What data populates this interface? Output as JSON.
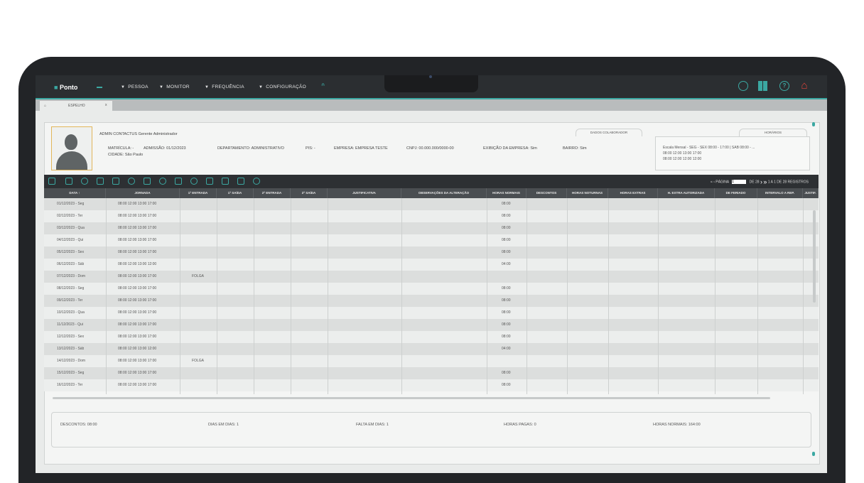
{
  "topbar": {
    "logo": "Ponto",
    "menu": [
      "PESSOA",
      "MONITOR",
      "FREQUÊNCIA",
      "CONFIGURAÇÃO"
    ]
  },
  "tab": {
    "label": "ESPELHO",
    "close": "x"
  },
  "employee": {
    "name_line": "ADMIN CONTACTUS Gerente Administrador",
    "matricula": "MATRÍCULA: -",
    "admissao": "ADMISSÃO: 01/12/2023",
    "departamento": "DEPARTAMENTO: ADMINISTRATIVO",
    "pis": "PIS: -",
    "empresa": "EMPRESA: EMPRESA TESTE",
    "cnpj": "CNPJ: 00.000.000/0000-00",
    "exibicao": "EXIBIÇÃO DA EMPRESA: Sim",
    "bairro": "BAIRRO: Sim",
    "cidade": "CIDADE: São Paulo"
  },
  "dados_tab": "DADOS COLABORADOR",
  "horarios_tab": "HORÁRIOS",
  "horarios_box": {
    "line1": "Escala Mensal - SEG - SEX 08:00 - 17:00 | SAB 08:00 - ...",
    "line2": "08:00 12:00 13:00 17:00",
    "line3": "08:00 12:00 12:00 12:00"
  },
  "pager": {
    "label": "PÁGINA",
    "value": "1",
    "of": "DE 28",
    "summary": "1 A 1 DE 28 REGISTROS"
  },
  "columns": [
    "DATA ↑",
    "JORNADA",
    "1ª ENTRADA",
    "1ª SAÍDA",
    "2ª ENTRADA",
    "2ª SAÍDA",
    "JUSTIFICATIVA",
    "OBSERVAÇÕES DA ALTERAÇÃO",
    "HORAS NORMAIS",
    "DESCONTOS",
    "HORAS NOTURNAS",
    "HORAS EXTRAS",
    "H. EXTRA AUTORIZADA",
    "DE FERIADO",
    "INTERVALO A REP.",
    "JUSTIF."
  ],
  "rows": [
    {
      "date": "01/12/2023 - Seg",
      "jornada": "08:00 12:00 13:00 17:00",
      "e1": "",
      "hn": "08:00"
    },
    {
      "date": "02/12/2023 - Ter",
      "jornada": "08:00 12:00 13:00 17:00",
      "e1": "",
      "hn": "08:00"
    },
    {
      "date": "03/12/2023 - Qua",
      "jornada": "08:00 12:00 13:00 17:00",
      "e1": "",
      "hn": "08:00"
    },
    {
      "date": "04/12/2023 - Qui",
      "jornada": "08:00 12:00 13:00 17:00",
      "e1": "",
      "hn": "08:00"
    },
    {
      "date": "05/12/2023 - Sex",
      "jornada": "08:00 12:00 13:00 17:00",
      "e1": "",
      "hn": "08:00"
    },
    {
      "date": "06/12/2023 - Sáb",
      "jornada": "08:00 12:00 13:00 12:00",
      "e1": "",
      "hn": "04:00"
    },
    {
      "date": "07/12/2023 - Dom",
      "jornada": "08:00 12:00 13:00 17:00",
      "e1": "FOLGA",
      "hn": ""
    },
    {
      "date": "08/12/2023 - Seg",
      "jornada": "08:00 12:00 13:00 17:00",
      "e1": "",
      "hn": "08:00"
    },
    {
      "date": "09/12/2023 - Ter",
      "jornada": "08:00 12:00 13:00 17:00",
      "e1": "",
      "hn": "08:00"
    },
    {
      "date": "10/12/2023 - Qua",
      "jornada": "08:00 12:00 13:00 17:00",
      "e1": "",
      "hn": "08:00"
    },
    {
      "date": "11/12/2023 - Qui",
      "jornada": "08:00 12:00 13:00 17:00",
      "e1": "",
      "hn": "08:00"
    },
    {
      "date": "12/12/2023 - Sex",
      "jornada": "08:00 12:00 13:00 17:00",
      "e1": "",
      "hn": "08:00"
    },
    {
      "date": "13/12/2023 - Sáb",
      "jornada": "08:00 12:00 13:00 12:00",
      "e1": "",
      "hn": "04:00"
    },
    {
      "date": "14/12/2023 - Dom",
      "jornada": "08:00 12:00 13:00 17:00",
      "e1": "FOLGA",
      "hn": ""
    },
    {
      "date": "15/12/2023 - Seg",
      "jornada": "08:00 12:00 13:00 17:00",
      "e1": "",
      "hn": "08:00"
    },
    {
      "date": "16/12/2023 - Ter",
      "jornada": "08:00 12:00 13:00 17:00",
      "e1": "",
      "hn": "08:00"
    }
  ],
  "footer": {
    "descontos": "DESCONTOS: 08:00",
    "dias": "DIAS EM DIAS: 1",
    "faltas": "FALTA EM DIAS: 1",
    "horas_pagas": "HORAS PAGAS: 0",
    "horas_normais": "HORAS NORMAIS: 164:00"
  },
  "colors": {
    "accent": "#3ba8a2",
    "topbar": "#2b2e31",
    "danger": "#e0443b"
  }
}
